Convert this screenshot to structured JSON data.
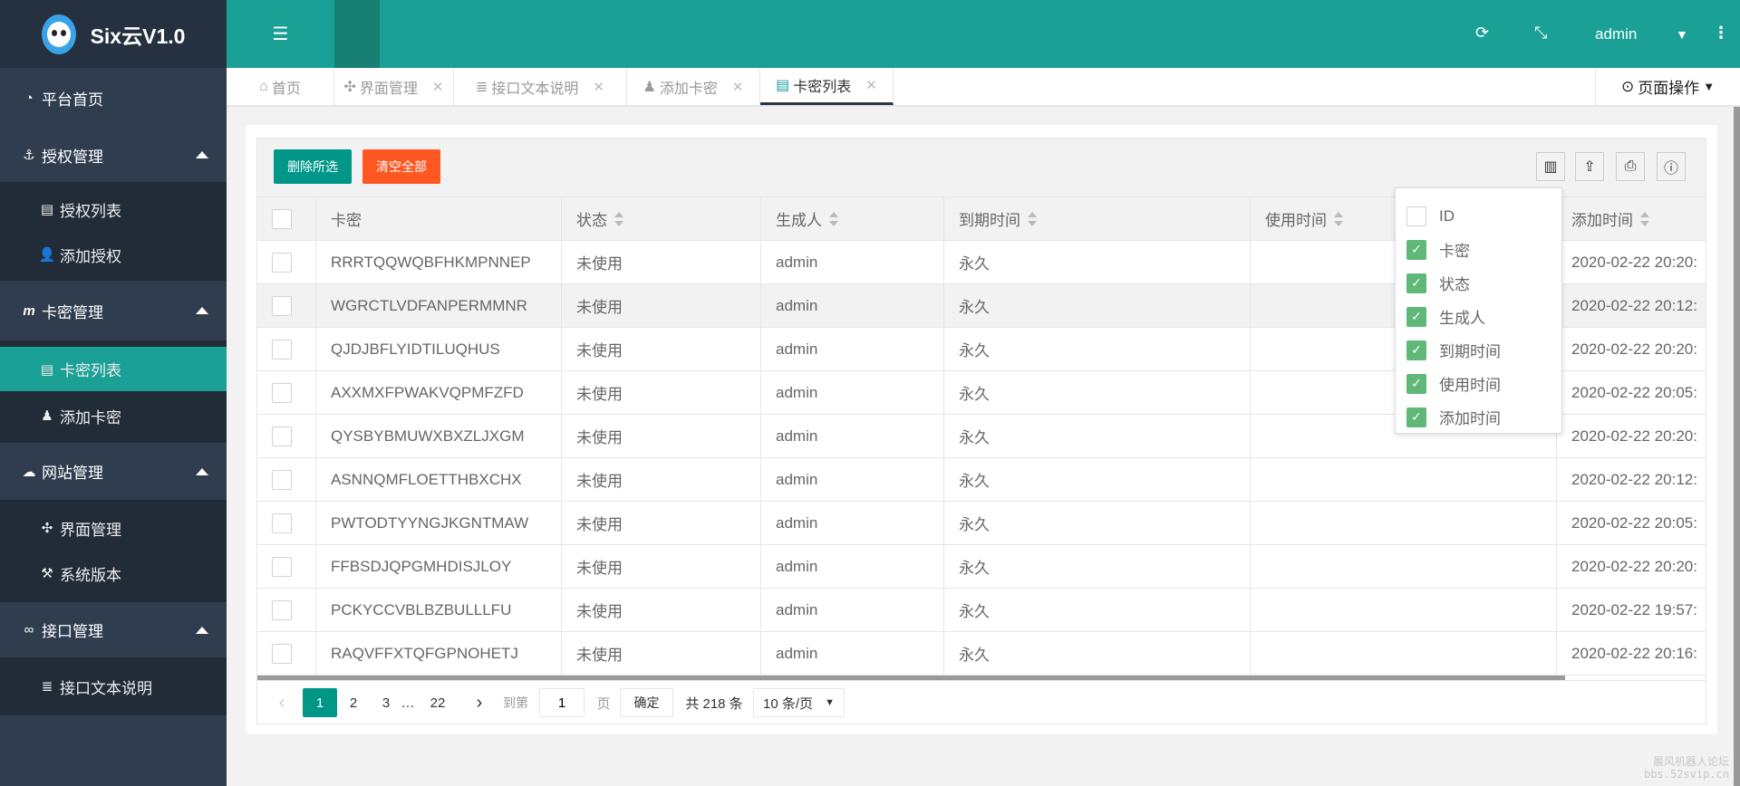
{
  "app": {
    "title": "Six云V1.0"
  },
  "sidebar": {
    "items": [
      {
        "label": "平台首页",
        "icon": "dashboard-icon"
      },
      {
        "label": "授权管理",
        "icon": "anchor-icon",
        "children": [
          {
            "label": "授权列表"
          },
          {
            "label": "添加授权"
          }
        ]
      },
      {
        "label": "卡密管理",
        "icon": "m-icon",
        "children": [
          {
            "label": "卡密列表",
            "active": true
          },
          {
            "label": "添加卡密"
          }
        ]
      },
      {
        "label": "网站管理",
        "icon": "cloud-icon",
        "children": [
          {
            "label": "界面管理"
          },
          {
            "label": "系统版本"
          }
        ]
      },
      {
        "label": "接口管理",
        "icon": "link-icon",
        "children": [
          {
            "label": "接口文本说明"
          }
        ]
      }
    ]
  },
  "header": {
    "user": "admin"
  },
  "tabs": [
    {
      "label": "首页"
    },
    {
      "label": "界面管理"
    },
    {
      "label": "接口文本说明"
    },
    {
      "label": "添加卡密"
    },
    {
      "label": "卡密列表",
      "active": true
    }
  ],
  "page_ops": "页面操作",
  "toolbar": {
    "delete_selected": "删除所选",
    "clear_all": "清空全部"
  },
  "table": {
    "columns": [
      "卡密",
      "状态",
      "生成人",
      "到期时间",
      "使用时间",
      "添加时间"
    ],
    "rows": [
      [
        "RRRTQQWQBFHKMPNNEP",
        "未使用",
        "admin",
        "永久",
        "",
        "2020-02-22 20:20:"
      ],
      [
        "WGRCTLVDFANPERMMNR",
        "未使用",
        "admin",
        "永久",
        "",
        "2020-02-22 20:12:"
      ],
      [
        "QJDJBFLYIDTILUQHUS",
        "未使用",
        "admin",
        "永久",
        "",
        "2020-02-22 20:20:"
      ],
      [
        "AXXMXFPWAKVQPMFZFD",
        "未使用",
        "admin",
        "永久",
        "",
        "2020-02-22 20:05:"
      ],
      [
        "QYSBYBMUWXBXZLJXGM",
        "未使用",
        "admin",
        "永久",
        "",
        "2020-02-22 20:20:"
      ],
      [
        "ASNNQMFLOETTHBXCHX",
        "未使用",
        "admin",
        "永久",
        "",
        "2020-02-22 20:12:"
      ],
      [
        "PWTODTYYNGJKGNTMAW",
        "未使用",
        "admin",
        "永久",
        "",
        "2020-02-22 20:05:"
      ],
      [
        "FFBSDJQPGMHDISJLOY",
        "未使用",
        "admin",
        "永久",
        "",
        "2020-02-22 20:20:"
      ],
      [
        "PCKYCCVBLBZBULLLFU",
        "未使用",
        "admin",
        "永久",
        "",
        "2020-02-22 19:57:"
      ],
      [
        "RAQVFFXTQFGPNOHETJ",
        "未使用",
        "admin",
        "永久",
        "",
        "2020-02-22 20:16:"
      ]
    ]
  },
  "column_filter": [
    {
      "label": "ID",
      "checked": false
    },
    {
      "label": "卡密",
      "checked": true
    },
    {
      "label": "状态",
      "checked": true
    },
    {
      "label": "生成人",
      "checked": true
    },
    {
      "label": "到期时间",
      "checked": true
    },
    {
      "label": "使用时间",
      "checked": true
    },
    {
      "label": "添加时间",
      "checked": true
    }
  ],
  "pager": {
    "pages": [
      "1",
      "2",
      "3",
      "…",
      "22"
    ],
    "current": "1",
    "goto_label": "到第",
    "goto_value": "1",
    "page_unit": "页",
    "confirm": "确定",
    "total": "共 218 条",
    "page_size": "10 条/页"
  },
  "watermark": {
    "line1": "晨风机器人论坛",
    "line2": "bbs.52svip.cn"
  },
  "colors": {
    "primary": "#1aa094",
    "danger": "#ff5722",
    "check": "#5fb878",
    "sidebar": "#2f3d4f"
  }
}
